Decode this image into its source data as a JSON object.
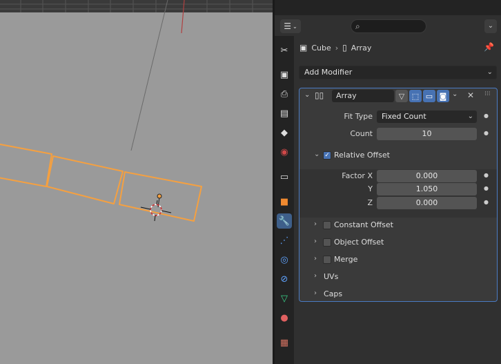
{
  "properties": {
    "breadcrumb": {
      "object": "Cube",
      "modifier": "Array"
    },
    "add_modifier": "Add Modifier",
    "modifier": {
      "name": "Array",
      "fit_type_label": "Fit Type",
      "fit_type_value": "Fixed Count",
      "count_label": "Count",
      "count_value": "10",
      "relative_offset_label": "Relative Offset",
      "relative_offset_checked": true,
      "factor_x_label": "Factor X",
      "factor_x_value": "0.000",
      "y_label": "Y",
      "y_value": "1.050",
      "z_label": "Z",
      "z_value": "0.000",
      "constant_offset_label": "Constant Offset",
      "object_offset_label": "Object Offset",
      "merge_label": "Merge",
      "uvs_label": "UVs",
      "caps_label": "Caps"
    }
  },
  "colors": {
    "selection_outline": "#f5a040",
    "active_tab": "#3e5f8a",
    "toggle_on": "#4772b3",
    "viewport_bg": "#9a9a9a"
  },
  "icons": {
    "tabs": [
      "tool-icon",
      "render-icon",
      "output-icon",
      "view-layer-icon",
      "scene-icon",
      "world-icon",
      "collection-icon",
      "object-icon",
      "modifier-wrench-icon",
      "particles-icon",
      "physics-icon",
      "constraints-icon",
      "data-icon",
      "material-icon",
      "texture-icon"
    ]
  }
}
